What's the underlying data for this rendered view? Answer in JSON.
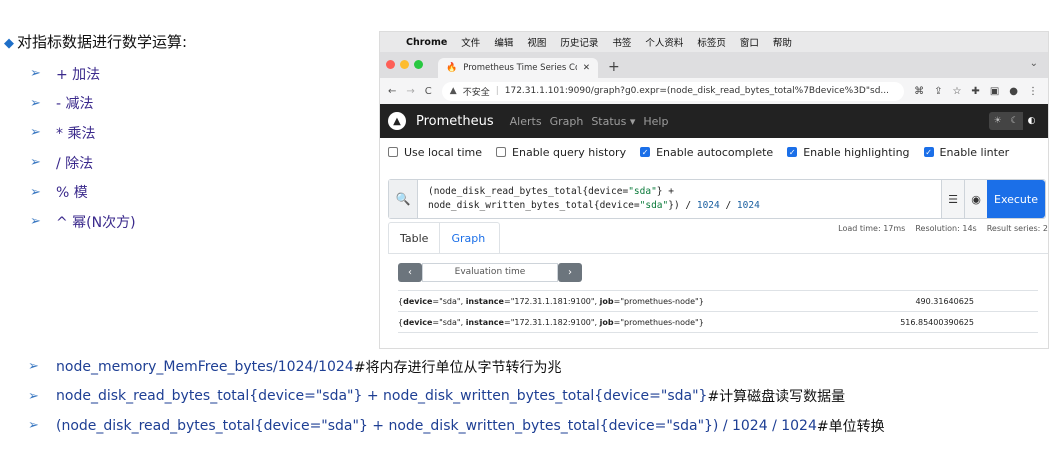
{
  "slide": {
    "heading": "对指标数据进行数学运算:",
    "ops": [
      "+ 加法",
      "- 减法",
      "* 乘法",
      "/ 除法",
      "% 模",
      "^ 幂(N次方)"
    ],
    "notes": [
      {
        "expr": "node_memory_MemFree_bytes/1024/1024 ",
        "comment": "#将内存进行单位从字节转行为兆"
      },
      {
        "expr": "node_disk_read_bytes_total{device=\"sda\"} + node_disk_written_bytes_total{device=\"sda\"} ",
        "comment": "#计算磁盘读写数据量"
      },
      {
        "expr": "(node_disk_read_bytes_total{device=\"sda\"} + node_disk_written_bytes_total{device=\"sda\"}) / 1024 / 1024 ",
        "comment": "#单位转换"
      }
    ]
  },
  "browser": {
    "menubar": [
      "Chrome",
      "文件",
      "编辑",
      "视图",
      "历史记录",
      "书签",
      "个人资料",
      "标签页",
      "窗口",
      "帮助"
    ],
    "tab_title": "Prometheus Time Series Collec",
    "insecure": "不安全",
    "url": "172.31.1.101:9090/graph?g0.expr=(node_disk_read_bytes_total%7Bdevice%3D\"sd..."
  },
  "prom": {
    "brand": "Prometheus",
    "nav": [
      "Alerts",
      "Graph",
      "Status ▾",
      "Help"
    ],
    "options": [
      {
        "label": "Use local time",
        "checked": false
      },
      {
        "label": "Enable query history",
        "checked": false
      },
      {
        "label": "Enable autocomplete",
        "checked": true
      },
      {
        "label": "Enable highlighting",
        "checked": true
      },
      {
        "label": "Enable linter",
        "checked": true
      }
    ],
    "execute_label": "Execute",
    "tab_table": "Table",
    "tab_graph": "Graph",
    "load_time": "Load time: 17ms",
    "resolution": "Resolution: 14s",
    "result_series": "Result series: 2",
    "evaluation_time": "Evaluation time",
    "rows": [
      {
        "device": "sda",
        "instance": "172.31.1.181:9100",
        "job": "promethues-node",
        "value": "490.31640625"
      },
      {
        "device": "sda",
        "instance": "172.31.1.182:9100",
        "job": "promethues-node",
        "value": "516.85400390625"
      }
    ]
  },
  "colors": {
    "accent": "#1b6fe8",
    "navbar": "#222222"
  }
}
